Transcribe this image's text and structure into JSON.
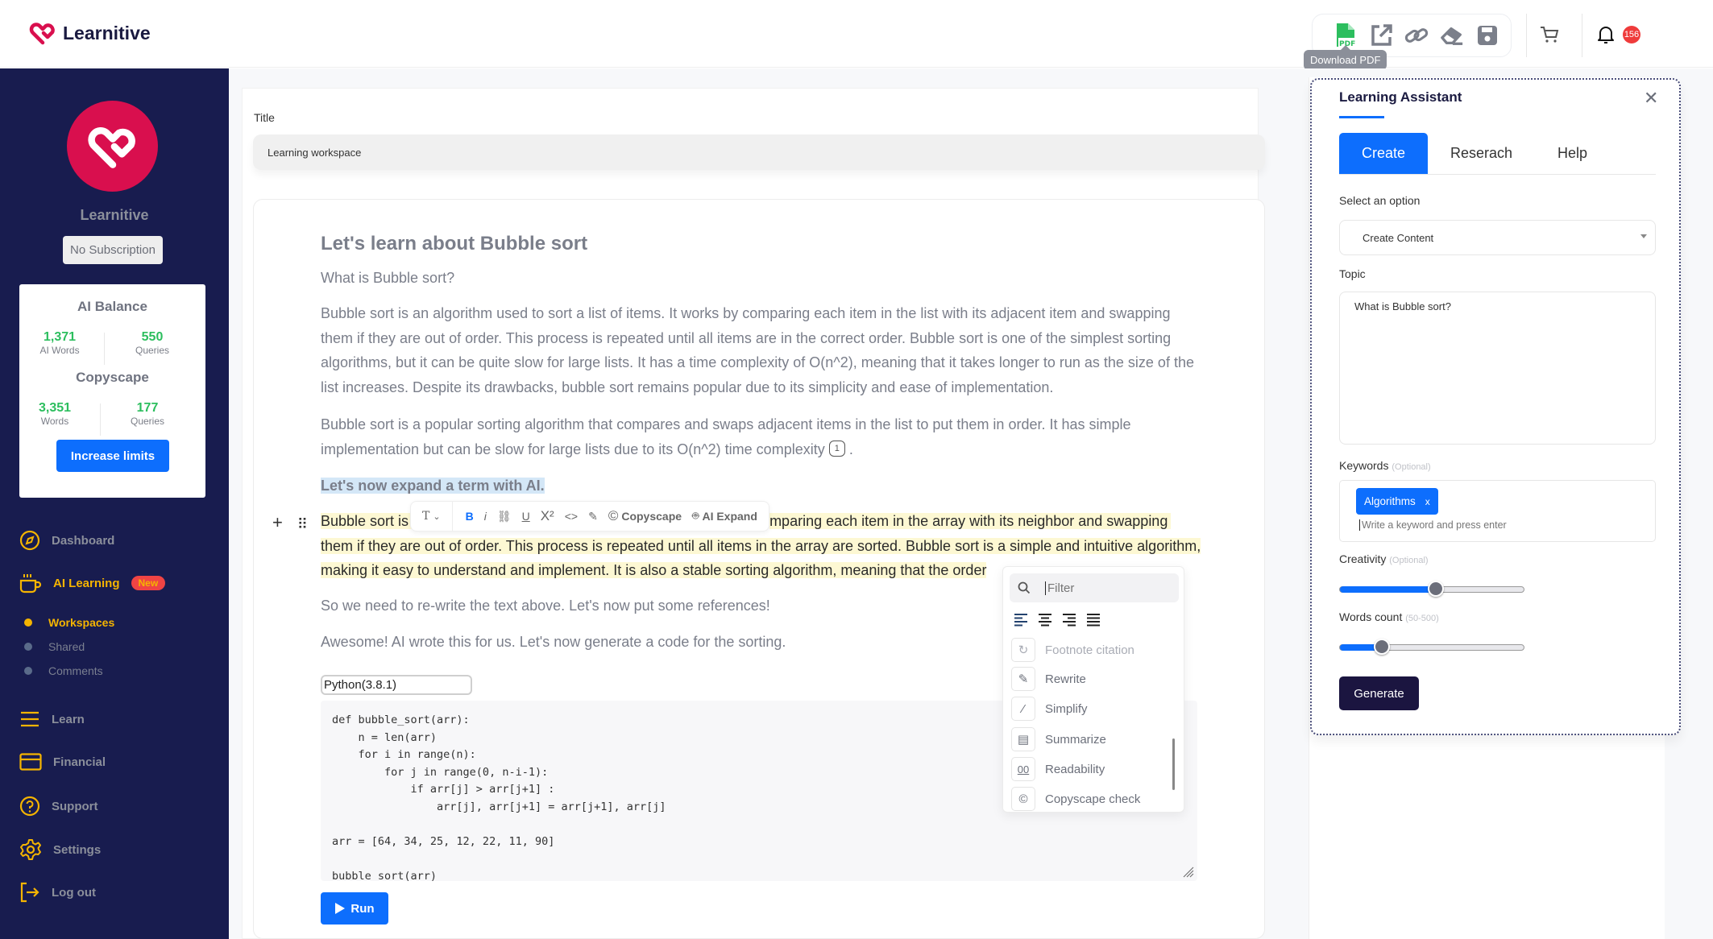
{
  "header": {
    "brand": "Learnitive",
    "tooltip": "Download PDF",
    "tools": [
      "download-pdf",
      "open-external",
      "copy-link",
      "eraser",
      "save"
    ],
    "notification_count": "156"
  },
  "sidebar": {
    "profile_name": "Learnitive",
    "subscription": "No Subscription",
    "ai_balance": {
      "title": "AI Balance",
      "words_value": "1,371",
      "words_label": "AI Words",
      "queries_value": "550",
      "queries_label": "Queries"
    },
    "copyscape": {
      "title": "Copyscape",
      "words_value": "3,351",
      "words_label": "Words",
      "queries_value": "177",
      "queries_label": "Queries"
    },
    "increase_label": "Increase limits",
    "nav": [
      {
        "label": "Dashboard",
        "icon": "compass-icon"
      },
      {
        "label": "AI Learning",
        "icon": "cup-icon",
        "badge": "New",
        "active": true
      },
      {
        "label": "Learn",
        "icon": "menu-icon"
      },
      {
        "label": "Financial",
        "icon": "card-icon"
      },
      {
        "label": "Support",
        "icon": "help-icon"
      },
      {
        "label": "Settings",
        "icon": "gear-icon"
      },
      {
        "label": "Log out",
        "icon": "logout-icon"
      }
    ],
    "subnav": [
      {
        "label": "Workspaces",
        "active": true
      },
      {
        "label": "Shared"
      },
      {
        "label": "Comments"
      }
    ]
  },
  "main": {
    "title_label": "Title",
    "title_value": "Learning workspace",
    "doc": {
      "heading": "Let's learn about Bubble sort",
      "question": "What is Bubble sort?",
      "para1_lines": [
        "Bubble sort is an algorithm used to sort a list of items. It works by comparing each item in the list with its adjacent item and swapping",
        "them if they are out of order. This process is repeated until all items are in the correct order. Bubble sort is one of the simplest sorting",
        "algorithms, but it can be quite slow for large lists. It has a time complexity of O(n^2), meaning that it takes longer to run as the size of the",
        "list increases. Despite its drawbacks, bubble sort remains popular due to its simplicity and ease of implementation."
      ],
      "para2_line1": "Bubble sort is a popular sorting algorithm that compares and swaps adjacent items in the list to put them in order. It has simple",
      "para2_line2": "implementation but can be slow for large lists due to its O(n^2) time complexity",
      "footnote": "1",
      "para2_end": ".",
      "expand_heading": "Let's now expand a term with AI.",
      "highlight_line1_start": "Bubble sort is",
      "highlight_line1_end": "mparing each item in the array with its neighbor and swapping",
      "highlight_line2": "them if they are out of order. This process is repeated until all items in the array are sorted. Bubble sort is a simple and intuitive algorithm,",
      "highlight_line3": "making it easy to understand and implement. It is also a stable sorting algorithm, meaning that the order",
      "para3": "So we need to re-write the text above. Let's now put some references!",
      "para4": "Awesome! AI wrote this for us. Let's now generate a code for the sorting."
    },
    "inline_toolbar": {
      "copyscape_label": "Copyscape",
      "ai_expand_label": "AI Expand"
    },
    "code": {
      "language": "Python(3.8.1)",
      "source": "def bubble_sort(arr):\n    n = len(arr)\n    for i in range(n):\n        for j in range(0, n-i-1):\n            if arr[j] > arr[j+1] :\n                arr[j], arr[j+1] = arr[j+1], arr[j]\n\narr = [64, 34, 25, 12, 22, 11, 90]\n\nbubble_sort(arr)",
      "run_label": "Run"
    },
    "slash_menu": {
      "filter_placeholder": "Filter",
      "items": [
        {
          "label": "Footnote citation",
          "icon": "footnote-icon",
          "disabled": true
        },
        {
          "label": "Rewrite",
          "icon": "rewrite-icon"
        },
        {
          "label": "Simplify",
          "icon": "magic-wand-icon"
        },
        {
          "label": "Summarize",
          "icon": "scroll-icon"
        },
        {
          "label": "Readability",
          "icon": "readability-icon"
        },
        {
          "label": "Copyscape check",
          "icon": "copyright-icon"
        }
      ]
    }
  },
  "assistant": {
    "title": "Learning Assistant",
    "tabs": [
      "Create",
      "Reserach",
      "Help"
    ],
    "active_tab": "Create",
    "select_label": "Select an option",
    "select_value": "Create Content",
    "topic_label": "Topic",
    "topic_value": "What is Bubble sort?",
    "keywords_label": "Keywords",
    "keywords_hint": "(Optional)",
    "keywords": [
      "Algorithms"
    ],
    "keyword_placeholder": "Write a keyword and press enter",
    "creativity_label": "Creativity",
    "creativity_hint": "(Optional)",
    "creativity_value": 0.52,
    "words_label": "Words count",
    "words_hint": "(50-500)",
    "words_value": 0.23,
    "generate_label": "Generate"
  },
  "colors": {
    "sidebar_bg": "#181c4f",
    "accent": "#0d6efd",
    "brand": "#d90f4e",
    "highlight": "#f5b400",
    "success": "#2cbe5e"
  }
}
